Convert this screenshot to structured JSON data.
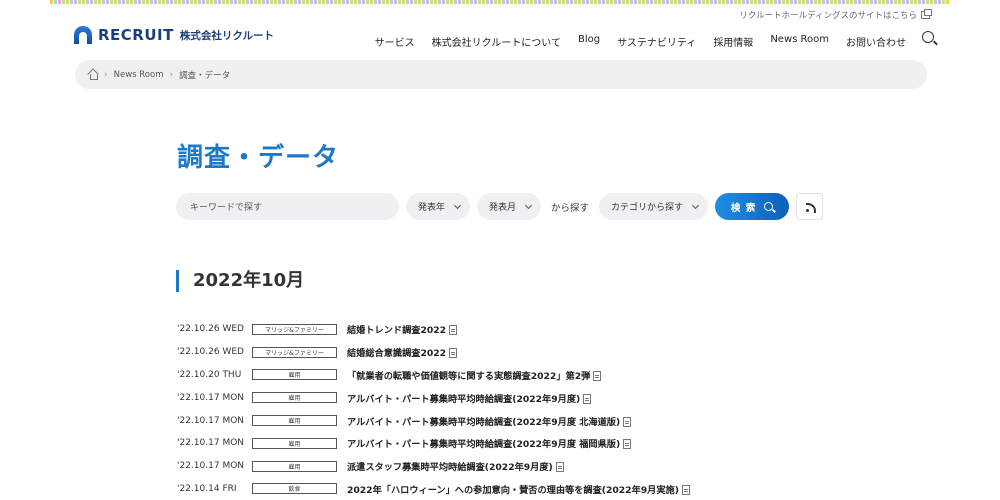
{
  "header": {
    "group_link": "リクルートホールディングスのサイトはこちら",
    "logo_en": "RECRUIT",
    "logo_jp": "株式会社リクルート",
    "nav": [
      "サービス",
      "株式会社リクルートについて",
      "Blog",
      "サステナビリティ",
      "採用情報",
      "News Room",
      "お問い合わせ"
    ]
  },
  "breadcrumb": [
    "News Room",
    "調査・データ"
  ],
  "page_title": "調査・データ",
  "search": {
    "keyword_placeholder": "キーワードで探す",
    "year_label": "発表年",
    "month_label": "発表月",
    "from_label": "から探す",
    "category_label": "カテゴリから探す",
    "search_button": "検 索"
  },
  "month_heading": "2022年10月",
  "news": [
    {
      "date": "'22.10.26",
      "day": "WED",
      "category": "マリッジ&ファミリー",
      "title": "結婚トレンド調査2022"
    },
    {
      "date": "'22.10.26",
      "day": "WED",
      "category": "マリッジ&ファミリー",
      "title": "結婚総合意識調査2022"
    },
    {
      "date": "'22.10.20",
      "day": "THU",
      "category": "雇用",
      "title": "「就業者の転職や価値観等に関する実態調査2022」第2弾"
    },
    {
      "date": "'22.10.17",
      "day": "MON",
      "category": "雇用",
      "title": "アルバイト・パート募集時平均時給調査(2022年9月度)"
    },
    {
      "date": "'22.10.17",
      "day": "MON",
      "category": "雇用",
      "title": "アルバイト・パート募集時平均時給調査(2022年9月度 北海道版)"
    },
    {
      "date": "'22.10.17",
      "day": "MON",
      "category": "雇用",
      "title": "アルバイト・パート募集時平均時給調査(2022年9月度 福岡県版)"
    },
    {
      "date": "'22.10.17",
      "day": "MON",
      "category": "雇用",
      "title": "派遣スタッフ募集時平均時給調査(2022年9月度)"
    },
    {
      "date": "'22.10.14",
      "day": "FRI",
      "category": "飲食",
      "title": "2022年「ハロウィーン」への参加意向・賛否の理由等を調査(2022年9月実施)"
    }
  ]
}
